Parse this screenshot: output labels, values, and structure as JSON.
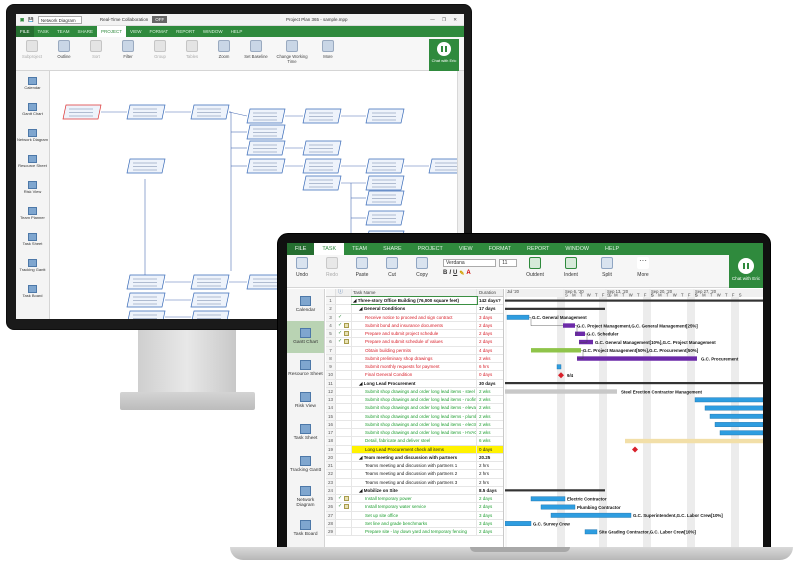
{
  "desktop": {
    "title_bar": {
      "project_field": "Network Diagram",
      "collab_label": "Real-Time Collaboration",
      "collab_state": "OFF",
      "file_name": "Project Plan 365 - sample.mpp",
      "window_controls": "— ❐ ✕"
    },
    "tabs": [
      {
        "label": "FILE"
      },
      {
        "label": "TASK"
      },
      {
        "label": "TEAM"
      },
      {
        "label": "SHARE"
      },
      {
        "label": "PROJECT"
      },
      {
        "label": "VIEW"
      },
      {
        "label": "FORMAT"
      },
      {
        "label": "REPORT"
      },
      {
        "label": "WINDOW"
      },
      {
        "label": "HELP"
      }
    ],
    "active_tab": "PROJECT",
    "ribbon": [
      {
        "label": "Subproject",
        "enabled": false
      },
      {
        "label": "Outline",
        "enabled": true
      },
      {
        "label": "Sort",
        "enabled": false
      },
      {
        "label": "Filter",
        "enabled": true
      },
      {
        "label": "Group",
        "enabled": false
      },
      {
        "label": "Tables",
        "enabled": false
      },
      {
        "label": "Zoom",
        "enabled": true
      },
      {
        "label": "Set Baseline",
        "enabled": true
      },
      {
        "label": "Change Working Time",
        "enabled": true
      },
      {
        "label": "More",
        "enabled": true
      }
    ],
    "chat_label": "Chat with Eric",
    "sidebar": [
      {
        "label": "Calendar",
        "icon": "calendar-icon"
      },
      {
        "label": "Gantt Chart",
        "icon": "gantt-icon"
      },
      {
        "label": "Network Diagram",
        "icon": "network-icon"
      },
      {
        "label": "Resource Sheet",
        "icon": "resource-icon"
      },
      {
        "label": "Risk View",
        "icon": "risk-icon"
      },
      {
        "label": "Team Planner",
        "icon": "team-icon"
      },
      {
        "label": "Task Sheet",
        "icon": "sheet-icon"
      },
      {
        "label": "Tracking Gantt",
        "icon": "tracking-icon"
      },
      {
        "label": "Task Board",
        "icon": "board-icon"
      }
    ]
  },
  "laptop": {
    "tabs": [
      {
        "label": "FILE"
      },
      {
        "label": "TASK"
      },
      {
        "label": "TEAM"
      },
      {
        "label": "SHARE"
      },
      {
        "label": "PROJECT"
      },
      {
        "label": "VIEW"
      },
      {
        "label": "FORMAT"
      },
      {
        "label": "REPORT"
      },
      {
        "label": "WINDOW"
      },
      {
        "label": "HELP"
      }
    ],
    "active_tab": "TASK",
    "ribbon": {
      "undo": "Undo",
      "redo": "Redo",
      "paste": "Paste",
      "cut": "Cut",
      "copy": "Copy",
      "font": "Verdana",
      "font_size": "11",
      "outdent": "Outdent",
      "indent": "Indent",
      "split": "Split",
      "more": "More"
    },
    "chat_label": "Chat with Eric",
    "sidebar": [
      {
        "label": "Calendar",
        "icon": "calendar-icon",
        "active": false
      },
      {
        "label": "Gantt Chart",
        "icon": "gantt-icon",
        "active": true
      },
      {
        "label": "Resource Sheet",
        "icon": "resource-icon",
        "active": false
      },
      {
        "label": "Risk View",
        "icon": "risk-icon",
        "active": false
      },
      {
        "label": "Task Sheet",
        "icon": "sheet-icon",
        "active": false
      },
      {
        "label": "Tracking Gantt",
        "icon": "tracking-icon",
        "active": false
      },
      {
        "label": "Network Diagram",
        "icon": "network-icon",
        "active": false
      },
      {
        "label": "Task Board",
        "icon": "board-icon",
        "active": false
      }
    ],
    "grid_headers": {
      "task_name": "Task Name",
      "duration": "Duration"
    },
    "tasks": [
      {
        "id": "1",
        "name": "Three-story Office Building (76,000 square feet)",
        "duration": "142 days?",
        "style": "summary",
        "level": 0
      },
      {
        "id": "2",
        "name": "General Conditions",
        "duration": "17 days",
        "style": "summary",
        "level": 1
      },
      {
        "id": "3",
        "name": "Receive notice to proceed and sign contract",
        "duration": "3 days",
        "style": "red",
        "level": 2
      },
      {
        "id": "4",
        "name": "Submit bond and insurance documents",
        "duration": "2 days",
        "style": "red",
        "level": 2
      },
      {
        "id": "5",
        "name": "Prepare and submit project schedule",
        "duration": "2 days",
        "style": "red",
        "level": 2
      },
      {
        "id": "6",
        "name": "Prepare and submit schedule of values",
        "duration": "2 days",
        "style": "red",
        "level": 2
      },
      {
        "id": "7",
        "name": "Obtain building permits",
        "duration": "4 days",
        "style": "red",
        "level": 2
      },
      {
        "id": "8",
        "name": "Submit preliminary shop drawings",
        "duration": "2 wks",
        "style": "red",
        "level": 2
      },
      {
        "id": "9",
        "name": "Submit monthly requests for payment",
        "duration": "6 hrs",
        "style": "red",
        "level": 2
      },
      {
        "id": "10",
        "name": "Final General Condition",
        "duration": "0 days",
        "style": "red",
        "level": 2
      },
      {
        "id": "11",
        "name": "Long Lead Procurement",
        "duration": "30 days",
        "style": "summary",
        "level": 1
      },
      {
        "id": "12",
        "name": "Submit shop drawings and order long lead items - steel",
        "duration": "2 wks",
        "style": "green",
        "level": 2
      },
      {
        "id": "13",
        "name": "Submit shop drawings and order long lead items - roofing",
        "duration": "2 wks",
        "style": "green",
        "level": 2
      },
      {
        "id": "14",
        "name": "Submit shop drawings and order long lead items - elevator",
        "duration": "2 wks",
        "style": "green",
        "level": 2
      },
      {
        "id": "15",
        "name": "Submit shop drawings and order long lead items - plumbing",
        "duration": "2 wks",
        "style": "green",
        "level": 2
      },
      {
        "id": "16",
        "name": "Submit shop drawings and order long lead items - electric",
        "duration": "2 wks",
        "style": "green",
        "level": 2
      },
      {
        "id": "17",
        "name": "Submit shop drawings and order long lead items - HVAC",
        "duration": "2 wks",
        "style": "green",
        "level": 2
      },
      {
        "id": "18",
        "name": "Detail, fabricate and deliver steel",
        "duration": "6 wks",
        "style": "green",
        "level": 2
      },
      {
        "id": "19",
        "name": "Long Lead Procurement check all items",
        "duration": "0 days",
        "style": "hl",
        "level": 2
      },
      {
        "id": "20",
        "name": "Team meeting and discussion with partners",
        "duration": "20.25",
        "style": "summary",
        "level": 1
      },
      {
        "id": "21",
        "name": "Teams meeting and discussion with partners 1",
        "duration": "2 hrs",
        "style": "black",
        "level": 2
      },
      {
        "id": "22",
        "name": "Teams meeting and discussion with partners 2",
        "duration": "2 hrs",
        "style": "black",
        "level": 2
      },
      {
        "id": "23",
        "name": "Teams meeting and discussion with partners 3",
        "duration": "2 hrs",
        "style": "black",
        "level": 2
      },
      {
        "id": "24",
        "name": "Mobilize on Site",
        "duration": "8.5 days",
        "style": "summary",
        "level": 1
      },
      {
        "id": "25",
        "name": "Install temporary power",
        "duration": "2 days",
        "style": "green",
        "level": 2
      },
      {
        "id": "26",
        "name": "Install temporary water service",
        "duration": "2 days",
        "style": "green",
        "level": 2
      },
      {
        "id": "27",
        "name": "Set up site office",
        "duration": "3 days",
        "style": "green",
        "level": 2
      },
      {
        "id": "28",
        "name": "Set line and grade benchmarks",
        "duration": "3 days",
        "style": "green",
        "level": 2
      },
      {
        "id": "29",
        "name": "Prepare site - lay down yard and temporary fencing",
        "duration": "2 days",
        "style": "green",
        "level": 2
      }
    ],
    "gantt_header": {
      "weeks": [
        "Jul '20",
        "Sep 6, '20",
        "Sep 13, '20",
        "Sep 20, '20",
        "Sep 27, '20"
      ],
      "days": "S M T W T F S"
    },
    "gantt_labels": [
      {
        "row": 3,
        "text": "G.C. General Management"
      },
      {
        "row": 4,
        "text": "G.C. Project Management,G.C. General Management[25%]"
      },
      {
        "row": 5,
        "text": "G.C. Scheduler"
      },
      {
        "row": 6,
        "text": "G.C. General Management[10%],G.C. Project Management"
      },
      {
        "row": 7,
        "text": "G.C. Project Management[50%],G.C. Procurement[50%]"
      },
      {
        "row": 8,
        "text": "G.C. Procurement"
      },
      {
        "row": 10,
        "text": "9/4"
      },
      {
        "row": 12,
        "text": "Steel Erection Contractor Management"
      },
      {
        "row": 25,
        "text": "Electric Contractor"
      },
      {
        "row": 26,
        "text": "Plumbing Contractor"
      },
      {
        "row": 27,
        "text": "G.C. Superintendent,G.C. Labor Crew[10%]"
      },
      {
        "row": 28,
        "text": "G.C. Survey Crew"
      },
      {
        "row": 29,
        "text": "Site Grading Contractor,G.C. Labor Crew[10%]"
      }
    ]
  }
}
